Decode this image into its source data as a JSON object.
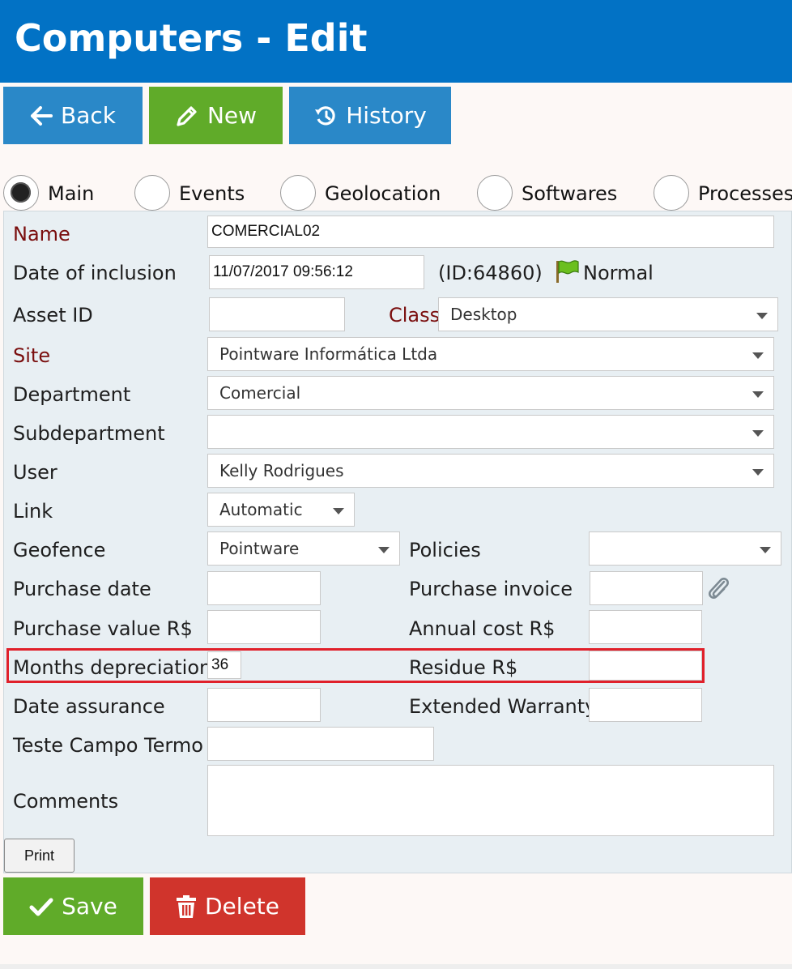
{
  "header": {
    "title": "Computers - Edit"
  },
  "toolbar": {
    "back_label": "Back",
    "new_label": "New",
    "history_label": "History"
  },
  "tabs": [
    {
      "label": "Main",
      "checked": true
    },
    {
      "label": "Events",
      "checked": false
    },
    {
      "label": "Geolocation",
      "checked": false
    },
    {
      "label": "Softwares",
      "checked": false
    },
    {
      "label": "Processes",
      "checked": false
    }
  ],
  "form": {
    "name": {
      "label": "Name",
      "value": "COMERCIAL02"
    },
    "date_inclusion": {
      "label": "Date of inclusion",
      "value": "11/07/2017 09:56:12"
    },
    "record_id": "(ID:64860)",
    "status": {
      "label": "Normal",
      "color": "#6bbf1e"
    },
    "asset_id": {
      "label": "Asset ID",
      "value": ""
    },
    "class": {
      "label": "Class",
      "value": "Desktop"
    },
    "site": {
      "label": "Site",
      "value": "Pointware Informática Ltda"
    },
    "department": {
      "label": "Department",
      "value": "Comercial"
    },
    "subdepartment": {
      "label": "Subdepartment",
      "value": ""
    },
    "user": {
      "label": "User",
      "value": "Kelly Rodrigues"
    },
    "link": {
      "label": "Link",
      "value": "Automatic"
    },
    "geofence": {
      "label": "Geofence",
      "value": "Pointware"
    },
    "policies": {
      "label": "Policies",
      "value": ""
    },
    "purchase_date": {
      "label": "Purchase date",
      "value": ""
    },
    "purchase_invoice": {
      "label": "Purchase invoice",
      "value": ""
    },
    "purchase_value": {
      "label": "Purchase value R$",
      "value": ""
    },
    "annual_cost": {
      "label": "Annual cost R$",
      "value": ""
    },
    "months_depreciation": {
      "label": "Months depreciation",
      "value": "36"
    },
    "residue": {
      "label": "Residue R$",
      "value": ""
    },
    "date_assurance": {
      "label": "Date assurance",
      "value": ""
    },
    "extended_warranty": {
      "label": "Extended Warranty",
      "value": ""
    },
    "teste_campo_termo": {
      "label": "Teste Campo Termo",
      "value": ""
    },
    "comments": {
      "label": "Comments",
      "value": ""
    }
  },
  "actions": {
    "print_label": "Print",
    "save_label": "Save",
    "delete_label": "Delete"
  },
  "colors": {
    "header": "#0272c5",
    "button_blue": "#2a88c8",
    "button_green": "#60ab29",
    "button_red": "#d0342c",
    "required_label": "#7a0e0e",
    "highlight": "#e0202a"
  },
  "icons": {
    "back": "arrow-left-icon",
    "new": "pencil-icon",
    "history": "history-icon",
    "status": "flag-icon",
    "invoice": "paperclip-icon",
    "save": "check-icon",
    "delete": "trash-icon"
  }
}
